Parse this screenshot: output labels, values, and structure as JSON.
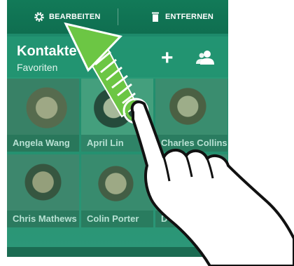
{
  "actionbar": {
    "edit_label": "BEARBEITEN",
    "edit_icon": "gear-icon",
    "remove_label": "ENTFERNEN",
    "remove_icon": "trash-icon"
  },
  "header": {
    "title": "Kontakte",
    "subtitle": "Favoriten",
    "add_icon": "plus-icon",
    "add_glyph": "+",
    "group_icon": "people-icon"
  },
  "favorites": [
    {
      "name": "Angela Wang"
    },
    {
      "name": "April Lin"
    },
    {
      "name": "Charles Collins"
    },
    {
      "name": "Chris Mathews"
    },
    {
      "name": "Colin Porter"
    },
    {
      "name": "D"
    }
  ],
  "gesture": {
    "arrow_icon": "drag-arrow-icon",
    "hand_icon": "pointing-hand-icon",
    "accent": "#6cc644"
  }
}
